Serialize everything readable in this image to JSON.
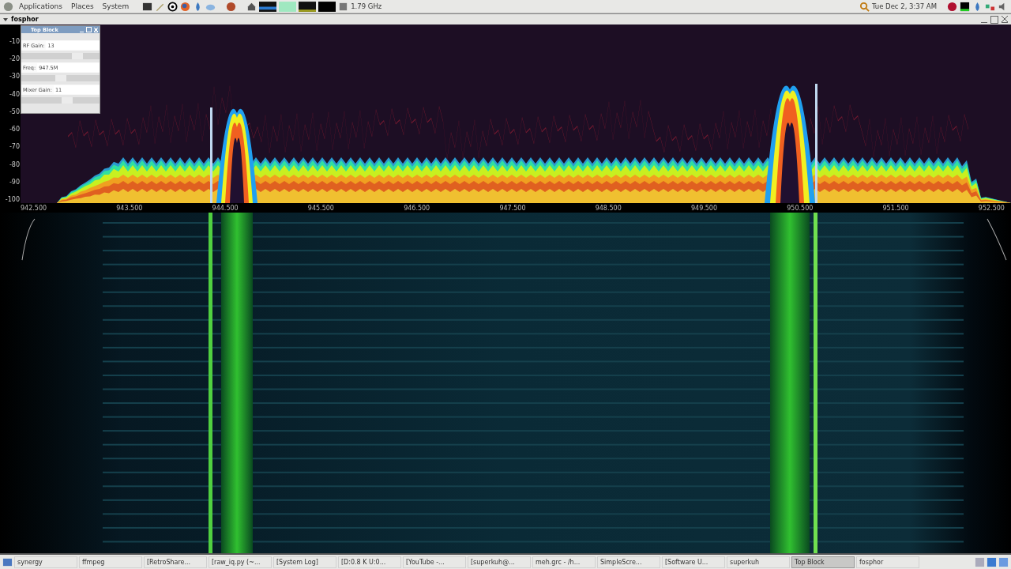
{
  "top_panel": {
    "menus": [
      "Applications",
      "Places",
      "System"
    ],
    "cpu_frequency": "1.79 GHz",
    "clock": "Tue Dec 2, 3:37 AM"
  },
  "window": {
    "title": "fosphor"
  },
  "spectrum": {
    "y_ticks": [
      "-10",
      "-20",
      "-30",
      "-40",
      "-50",
      "-60",
      "-70",
      "-80",
      "-90",
      "-100"
    ],
    "x_ticks": [
      "942.500",
      "943.500",
      "944.500",
      "945.500",
      "946.500",
      "947.500",
      "948.500",
      "949.500",
      "950.500",
      "951.500",
      "952.500"
    ]
  },
  "control_window": {
    "title": "Top Block",
    "controls": [
      {
        "label": "RF Gain:",
        "value": "13",
        "level": 0.75
      },
      {
        "label": "Freq:",
        "value": "947.5M",
        "level": 0.5
      },
      {
        "label": "Mixer Gain:",
        "value": "11",
        "level": 0.6
      }
    ]
  },
  "taskbar": [
    {
      "label": "synergy",
      "selected": false
    },
    {
      "label": "ffmpeg",
      "selected": false
    },
    {
      "label": "[RetroShare...",
      "selected": false
    },
    {
      "label": "[raw_iq.py (~...",
      "selected": false
    },
    {
      "label": "[System Log]",
      "selected": false
    },
    {
      "label": "[D:0.8 K U:0...",
      "selected": false
    },
    {
      "label": "[YouTube -...",
      "selected": false
    },
    {
      "label": "[superkuh@...",
      "selected": false
    },
    {
      "label": "meh.grc - /h...",
      "selected": false
    },
    {
      "label": "SimpleScre...",
      "selected": false
    },
    {
      "label": "[Software U...",
      "selected": false
    },
    {
      "label": "superkuh",
      "selected": false
    },
    {
      "label": "Top Block",
      "selected": true
    },
    {
      "label": "fosphor",
      "selected": false
    }
  ]
}
